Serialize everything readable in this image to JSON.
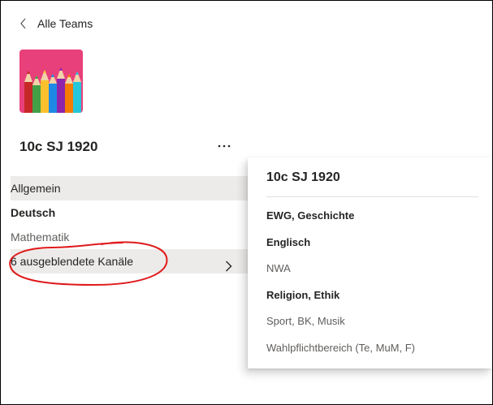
{
  "nav": {
    "back_label": "Alle Teams"
  },
  "team": {
    "name": "10c SJ 1920",
    "more_label": "···"
  },
  "channels": [
    {
      "label": "Allgemein",
      "style": "active"
    },
    {
      "label": "Deutsch",
      "style": "bold"
    },
    {
      "label": "Mathematik",
      "style": "muted"
    },
    {
      "label": "6 ausgeblendete Kanäle",
      "style": "hidden-row"
    }
  ],
  "flyout": {
    "title": "10c SJ 1920",
    "items": [
      {
        "label": "EWG, Geschichte",
        "style": "bold"
      },
      {
        "label": "Englisch",
        "style": "bold"
      },
      {
        "label": "NWA",
        "style": "muted"
      },
      {
        "label": "Religion, Ethik",
        "style": "bold"
      },
      {
        "label": "Sport, BK, Musik",
        "style": "muted"
      },
      {
        "label": "Wahlpflichtbereich (Te, MuM, F)",
        "style": "muted"
      }
    ]
  },
  "colors": {
    "avatar_bg": "#e8407a",
    "annotation": "#e0191b",
    "selected_bg": "#edebe9"
  },
  "icons": {
    "back": "chevron-left-icon",
    "more": "more-horizontal-icon",
    "expand": "chevron-right-icon"
  }
}
